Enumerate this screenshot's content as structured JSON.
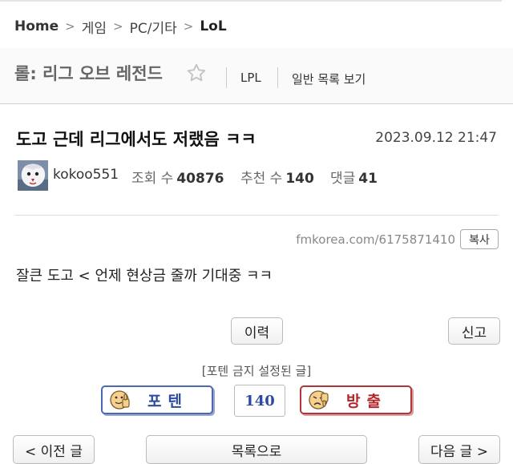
{
  "breadcrumb": {
    "home": "Home",
    "items": [
      "게임",
      "PC/기타"
    ],
    "current": "LoL"
  },
  "board": {
    "title": "롤: 리그 오브 레전드",
    "links": [
      "LPL",
      "일반 목록 보기"
    ]
  },
  "post": {
    "title": "도고 근데 리그에서도 저랬음 ㅋㅋ",
    "date": "2023.09.12 21:47",
    "author": "kokoo551",
    "views_label": "조회 수",
    "views": "40876",
    "recommend_label": "추천 수",
    "recommend": "140",
    "comments_label": "댓글",
    "comments": "41",
    "url": "fmkorea.com/6175871410",
    "copy_label": "복사",
    "body": "잘큰 도고 < 언제 현상금 줄까 기대중 ㅋㅋ"
  },
  "actions": {
    "history": "이력",
    "report": "신고"
  },
  "vote": {
    "notice": "[포텐 금지 설정된 글]",
    "up_label": "포텐",
    "down_label": "방출",
    "count": "140"
  },
  "nav": {
    "prev": "< 이전 글",
    "list": "목록으로",
    "next": "다음 글 >"
  }
}
